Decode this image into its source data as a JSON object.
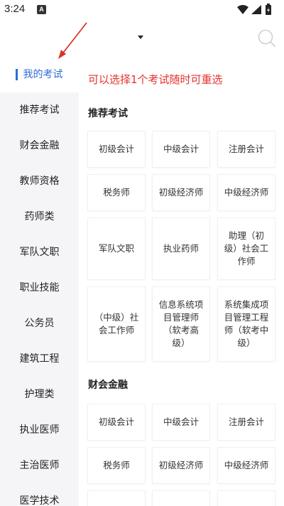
{
  "status_bar": {
    "time": "3:24",
    "notif_letter": "A"
  },
  "header": {
    "title": ""
  },
  "sidebar": {
    "items": [
      {
        "label": "我的考试",
        "active": true
      },
      {
        "label": "推荐考试"
      },
      {
        "label": "财会金融"
      },
      {
        "label": "教师资格"
      },
      {
        "label": "药师类"
      },
      {
        "label": "军队文职"
      },
      {
        "label": "职业技能"
      },
      {
        "label": "公务员"
      },
      {
        "label": "建筑工程"
      },
      {
        "label": "护理类"
      },
      {
        "label": "执业医师"
      },
      {
        "label": "主治医师"
      },
      {
        "label": "医学技术"
      }
    ]
  },
  "main": {
    "hint": "可以选择1个考试随时可重选",
    "sections": [
      {
        "title": "推荐考试",
        "cards": [
          "初级会计",
          "中级会计",
          "注册会计",
          "税务师",
          "初级经济师",
          "中级经济师",
          "军队文职",
          "执业药师",
          "助理（初级）社会工作师",
          "（中级）社会工作师",
          "信息系统项目管理师（软考高级）",
          "系统集成项目管理工程师（软考中级）"
        ]
      },
      {
        "title": "财会金融",
        "cards": [
          "初级会计",
          "中级会计",
          "注册会计",
          "税务师",
          "初级经济师",
          "中级经济师"
        ]
      }
    ]
  },
  "colors": {
    "accent": "#2e6cd8",
    "hint_red": "#e5322d",
    "arrow_red": "#d9352c",
    "sidebar_bg": "#f5f5f7"
  },
  "icons": {
    "search": "search-icon",
    "dropdown": "caret-down-icon",
    "wifi": "wifi-icon",
    "signal": "signal-icon",
    "battery": "battery-icon"
  }
}
